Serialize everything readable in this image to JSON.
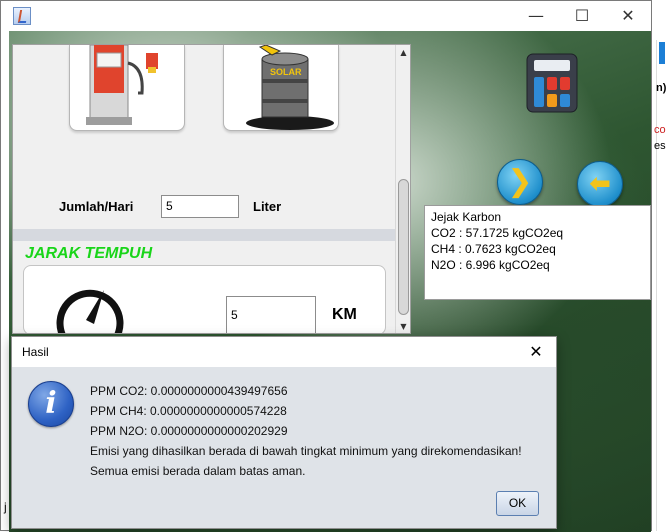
{
  "background_app": {
    "fragment_1": "n)",
    "fragment_2": "co",
    "fragment_3": "es",
    "fragment_4": "j"
  },
  "window": {
    "minimize_glyph": "—",
    "maximize_glyph": "☐",
    "close_glyph": "✕"
  },
  "fuel": {
    "pump_icon": "fuel-pump-icon",
    "solar_icon": "solar-barrel-icon",
    "barrel_label": "SOLAR",
    "jumlah_label": "Jumlah/Hari",
    "jumlah_value": "5",
    "unit": "Liter"
  },
  "jarak": {
    "title": "JARAK TEMPUH",
    "icon": "speedometer-icon",
    "value": "5",
    "unit": "KM"
  },
  "nav": {
    "next_glyph": "❯",
    "back_glyph": "⬅"
  },
  "jejak": {
    "title": "Jejak Karbon",
    "co2": "CO2 : 57.1725 kgCO2eq",
    "ch4": "CH4 : 0.7623 kgCO2eq",
    "n2o": "N2O : 6.996 kgCO2eq"
  },
  "dialog": {
    "title": "Hasil",
    "close_glyph": "✕",
    "icon_glyph": "i",
    "lines": [
      "PPM CO2: 0.0000000000439497656",
      "PPM CH4: 0.0000000000000574228",
      "PPM N2O: 0.0000000000000202929",
      "Emisi yang dihasilkan berada di bawah tingkat minimum yang direkomendasikan!",
      "Semua emisi berada dalam batas aman."
    ],
    "ok_label": "OK"
  },
  "colors": {
    "jarak_title": "#19d519",
    "ok_border": "#5b7fb1"
  }
}
